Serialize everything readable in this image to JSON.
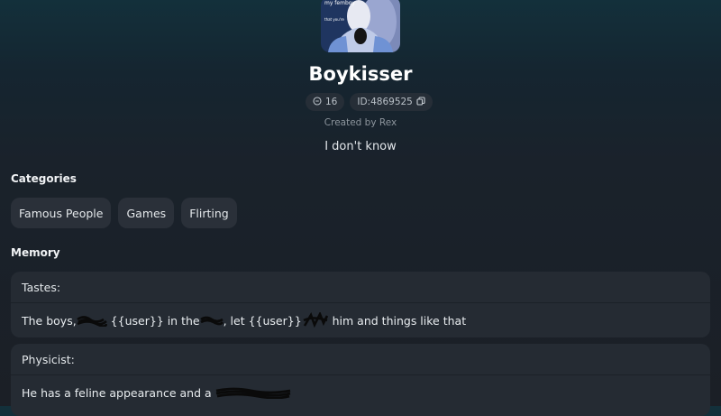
{
  "character": {
    "name": "Boykisser",
    "avatar_caption_top": "my femboy",
    "avatar_caption_mid": "that you're",
    "chat_count": "16",
    "id_text": "ID:4869525",
    "created_by": "Created by Rex",
    "tagline": "I don't know"
  },
  "categories": {
    "heading": "Categories",
    "items": [
      "Famous People",
      "Games",
      "Flirting"
    ]
  },
  "memory": {
    "heading": "Memory",
    "entries": [
      {
        "title": "Tastes:",
        "parts": [
          "The boys,",
          " {{user}} in the",
          ", let {{user}}",
          " him and things like that"
        ]
      },
      {
        "title": "Physicist:",
        "parts": [
          "He has a feline appearance and a "
        ]
      }
    ]
  },
  "icons": {
    "chat": "chat-bubble-icon",
    "copy": "copy-icon"
  },
  "colors": {
    "background_top": "#13303b",
    "background_bottom": "#1b1f26",
    "card": "#252b33",
    "chip": "#2a3039"
  }
}
